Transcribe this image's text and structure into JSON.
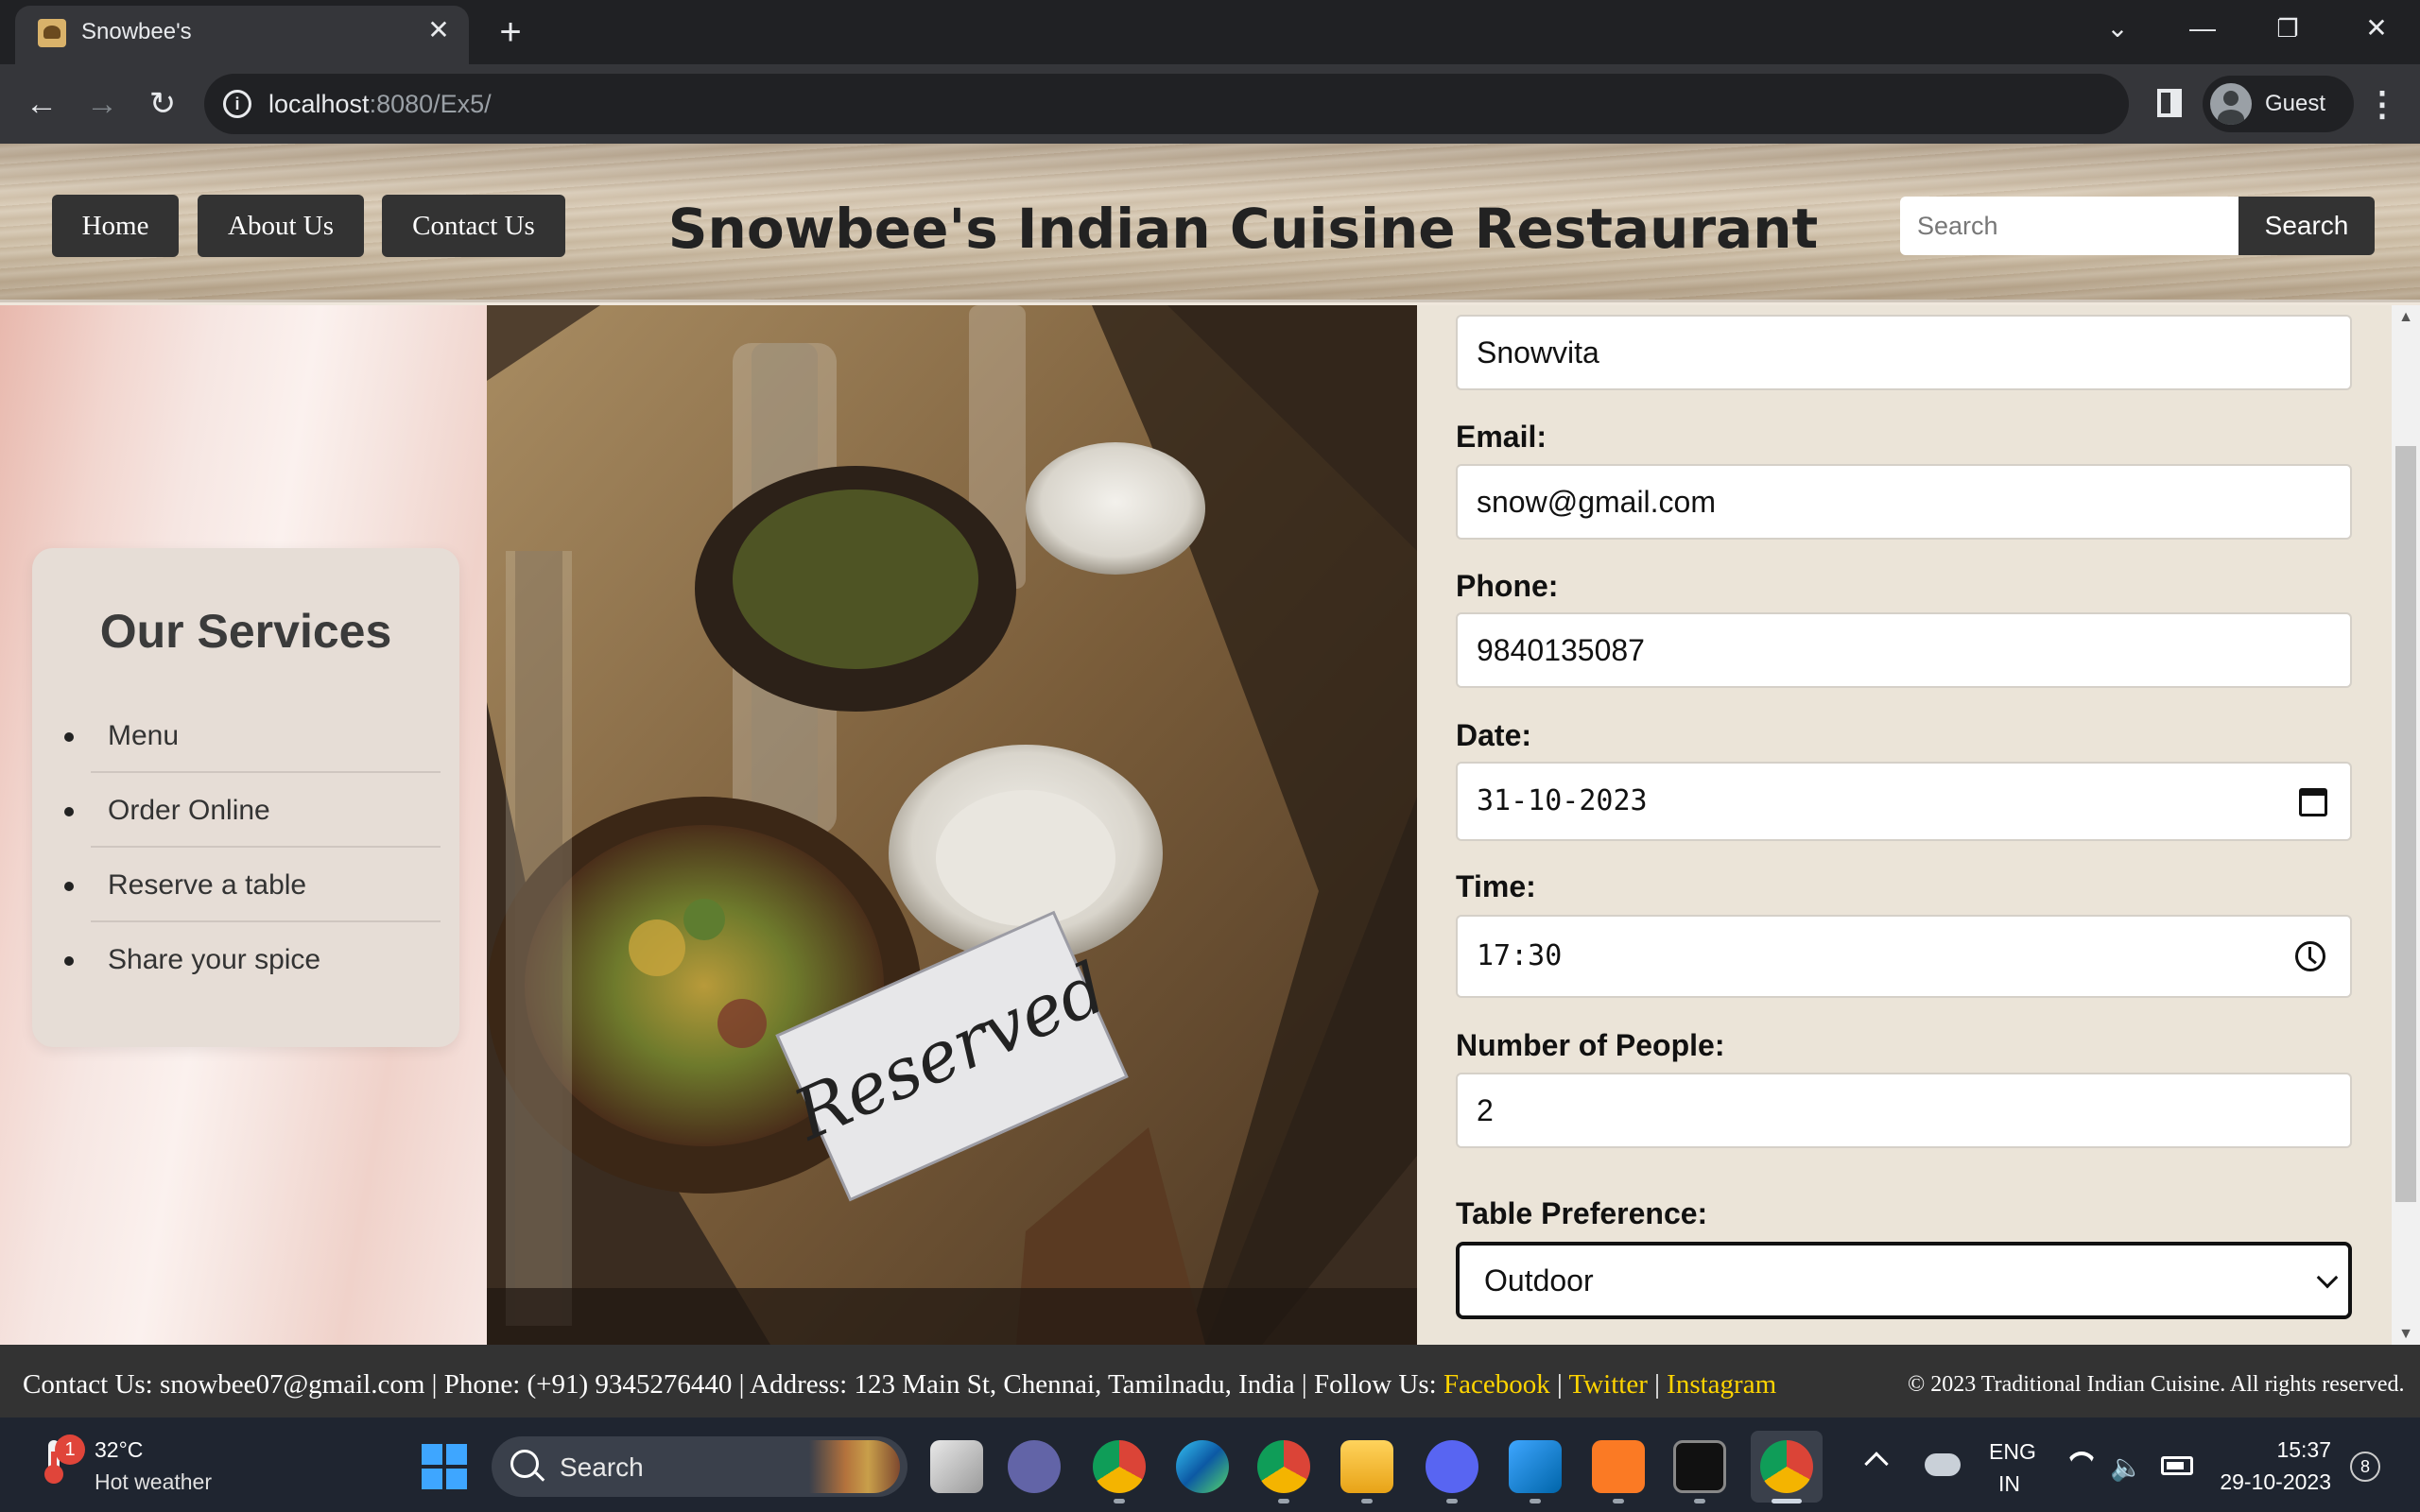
{
  "browser": {
    "tab_title": "Snowbee's",
    "url_host": "localhost",
    "url_rest": ":8080/Ex5/",
    "profile_label": "Guest"
  },
  "header": {
    "nav": [
      "Home",
      "About Us",
      "Contact Us"
    ],
    "title": "Snowbee's Indian Cuisine Restaurant",
    "search_placeholder": "Search",
    "search_button": "Search"
  },
  "sidebar": {
    "title": "Our Services",
    "items": [
      "Menu",
      "Order Online",
      "Reserve a table",
      "Share your spice"
    ]
  },
  "photo": {
    "sign_text": "Reserved"
  },
  "form": {
    "name_value": "Snowvita",
    "email_label": "Email:",
    "email_value": "snow@gmail.com",
    "phone_label": "Phone:",
    "phone_value": "9840135087",
    "date_label": "Date:",
    "date_value": "31-10-2023",
    "time_label": "Time:",
    "time_value": "17:30",
    "people_label": "Number of People:",
    "people_value": "2",
    "table_label": "Table Preference:",
    "table_value": "Outdoor"
  },
  "footer": {
    "contact": "Contact Us: snowbee07@gmail.com | Phone: (+91) 9345276440 | Address: 123 Main St, Chennai, Tamilnadu, India | Follow Us: ",
    "facebook": "Facebook",
    "sep1": " | ",
    "twitter": "Twitter",
    "sep2": " | ",
    "instagram": "Instagram",
    "copyright": "© 2023 Traditional Indian Cuisine. All rights reserved."
  },
  "taskbar": {
    "weather_temp": "32°C",
    "weather_desc": "Hot weather",
    "weather_badge": "1",
    "search_label": "Search",
    "lang_line1": "ENG",
    "lang_line2": "IN",
    "time": "15:37",
    "date": "29-10-2023",
    "notification_count": "8"
  },
  "colors": {
    "nav_button_bg": "#333333",
    "footer_bg": "#333333",
    "social_link": "#ffd400",
    "form_panel_bg": "#ebe4d8"
  }
}
